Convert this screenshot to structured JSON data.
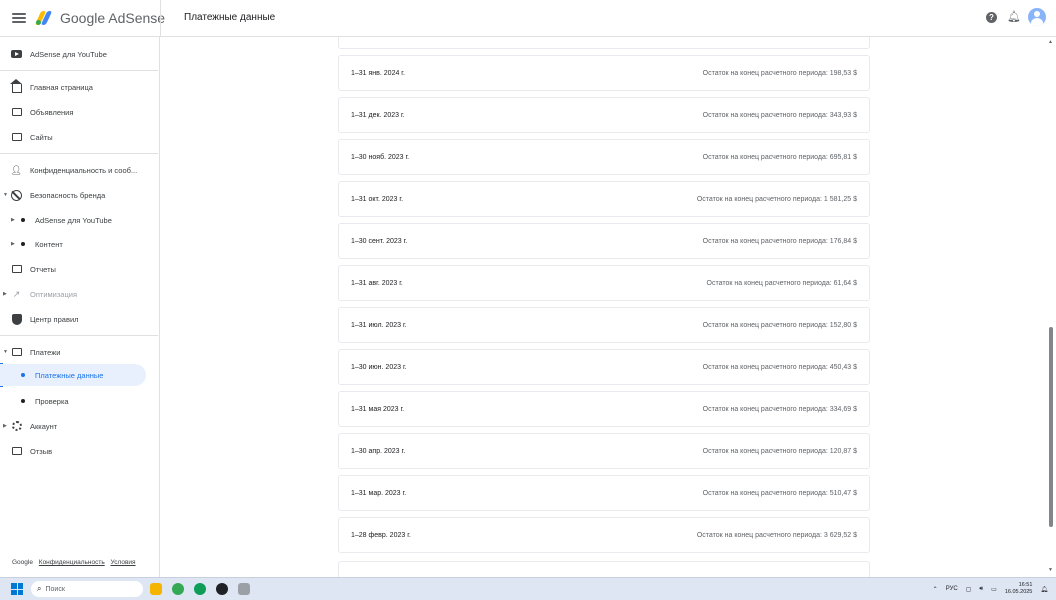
{
  "header": {
    "logo_text": "Google AdSense",
    "page_title": "Платежные данные"
  },
  "sidebar": {
    "items": [
      {
        "label": "AdSense для YouTube"
      },
      {
        "label": "Главная страница"
      },
      {
        "label": "Объявления"
      },
      {
        "label": "Сайты"
      },
      {
        "label": "Конфиденциальность и сооб..."
      },
      {
        "label": "Безопасность бренда"
      },
      {
        "label": "AdSense для YouTube"
      },
      {
        "label": "Контент"
      },
      {
        "label": "Отчеты"
      },
      {
        "label": "Оптимизация"
      },
      {
        "label": "Центр правил"
      },
      {
        "label": "Платежи"
      },
      {
        "label": "Платежные данные"
      },
      {
        "label": "Проверка"
      },
      {
        "label": "Аккаунт"
      },
      {
        "label": "Отзыв"
      }
    ],
    "footer": {
      "google": "Google",
      "privacy": "Конфиденциальность",
      "terms": "Условия"
    }
  },
  "payments": [
    {
      "period": "1–31 янв. 2024 г.",
      "balance": "Остаток на конец расчетного периода: 198,53 $"
    },
    {
      "period": "1–31 дек. 2023 г.",
      "balance": "Остаток на конец расчетного периода: 343,93 $"
    },
    {
      "period": "1–30 нояб. 2023 г.",
      "balance": "Остаток на конец расчетного периода: 695,81 $"
    },
    {
      "period": "1–31 окт. 2023 г.",
      "balance": "Остаток на конец расчетного периода: 1 581,25 $"
    },
    {
      "period": "1–30 сент. 2023 г.",
      "balance": "Остаток на конец расчетного периода: 176,84 $"
    },
    {
      "period": "1–31 авг. 2023 г.",
      "balance": "Остаток на конец расчетного периода: 61,64 $"
    },
    {
      "period": "1–31 июл. 2023 г.",
      "balance": "Остаток на конец расчетного периода: 152,80 $"
    },
    {
      "period": "1–30 июн. 2023 г.",
      "balance": "Остаток на конец расчетного периода: 450,43 $"
    },
    {
      "period": "1–31 мая 2023 г.",
      "balance": "Остаток на конец расчетного периода: 334,69 $"
    },
    {
      "period": "1–30 апр. 2023 г.",
      "balance": "Остаток на конец расчетного периода: 120,87 $"
    },
    {
      "period": "1–31 мар. 2023 г.",
      "balance": "Остаток на конец расчетного периода: 510,47 $"
    },
    {
      "period": "1–28 февр. 2023 г.",
      "balance": "Остаток на конец расчетного периода: 3 629,52 $"
    }
  ],
  "taskbar": {
    "search_placeholder": "Поиск",
    "lang": "РУС",
    "time": "16:51",
    "date": "16.05.2025"
  },
  "colors": {
    "accent": "#1a73e8",
    "active_bg": "#e8f0fe"
  }
}
